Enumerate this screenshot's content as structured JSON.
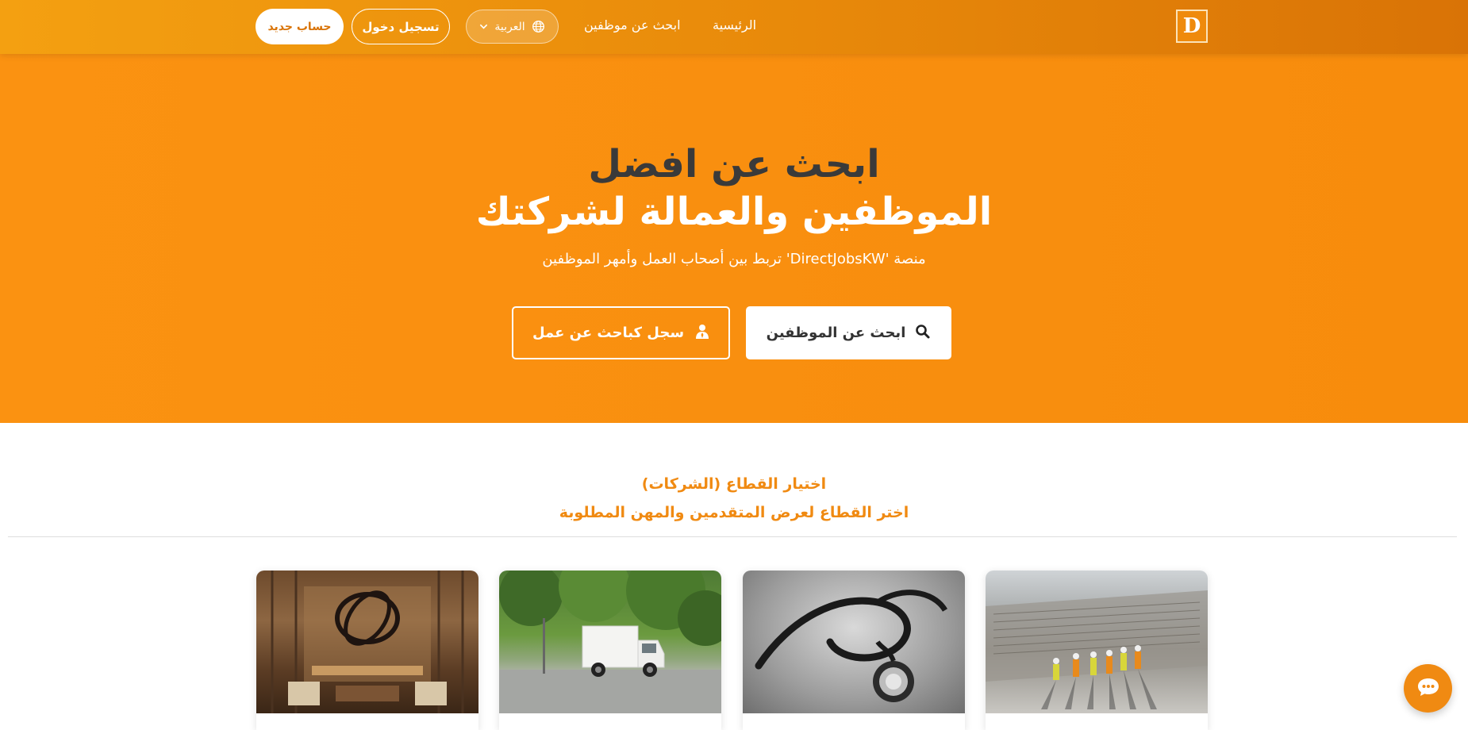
{
  "navbar": {
    "logo_text": "D",
    "home_label": "الرئيسية",
    "find_employees_label": "ابحث عن موظفين",
    "language_label": "العربية",
    "login_label": "تسجيل دخول",
    "signup_label": "حساب جديد"
  },
  "hero": {
    "title_line1": "ابحث عن افضل",
    "title_line2": "الموظفين والعمالة لشركتك",
    "subtitle": "منصة 'DirectJobsKW' تربط بين أصحاب العمل وأمهر الموظفين",
    "search_button_label": "ابحث عن الموظفين",
    "register_button_label": "سجل كباحث عن عمل"
  },
  "sectors": {
    "title": "اختيار القطاع (الشركات)",
    "subtitle": "اختر القطاع لعرض المتقدمين والمهن المطلوبة",
    "cards": [
      {
        "image": "construction-site-photo"
      },
      {
        "image": "stethoscope-photo"
      },
      {
        "image": "delivery-truck-photo"
      },
      {
        "image": "restaurant-interior-photo"
      }
    ]
  },
  "icons": {
    "globe": "globe-icon",
    "chevron": "chevron-down-icon",
    "search": "search-icon",
    "user": "user-icon",
    "chat": "chat-icon"
  },
  "colors": {
    "brand_orange": "#f98f0f",
    "nav_gradient_start": "#f4a011",
    "nav_gradient_end": "#d97306",
    "section_heading": "#f08a12",
    "hero_dark_text": "#3a3a3a"
  }
}
